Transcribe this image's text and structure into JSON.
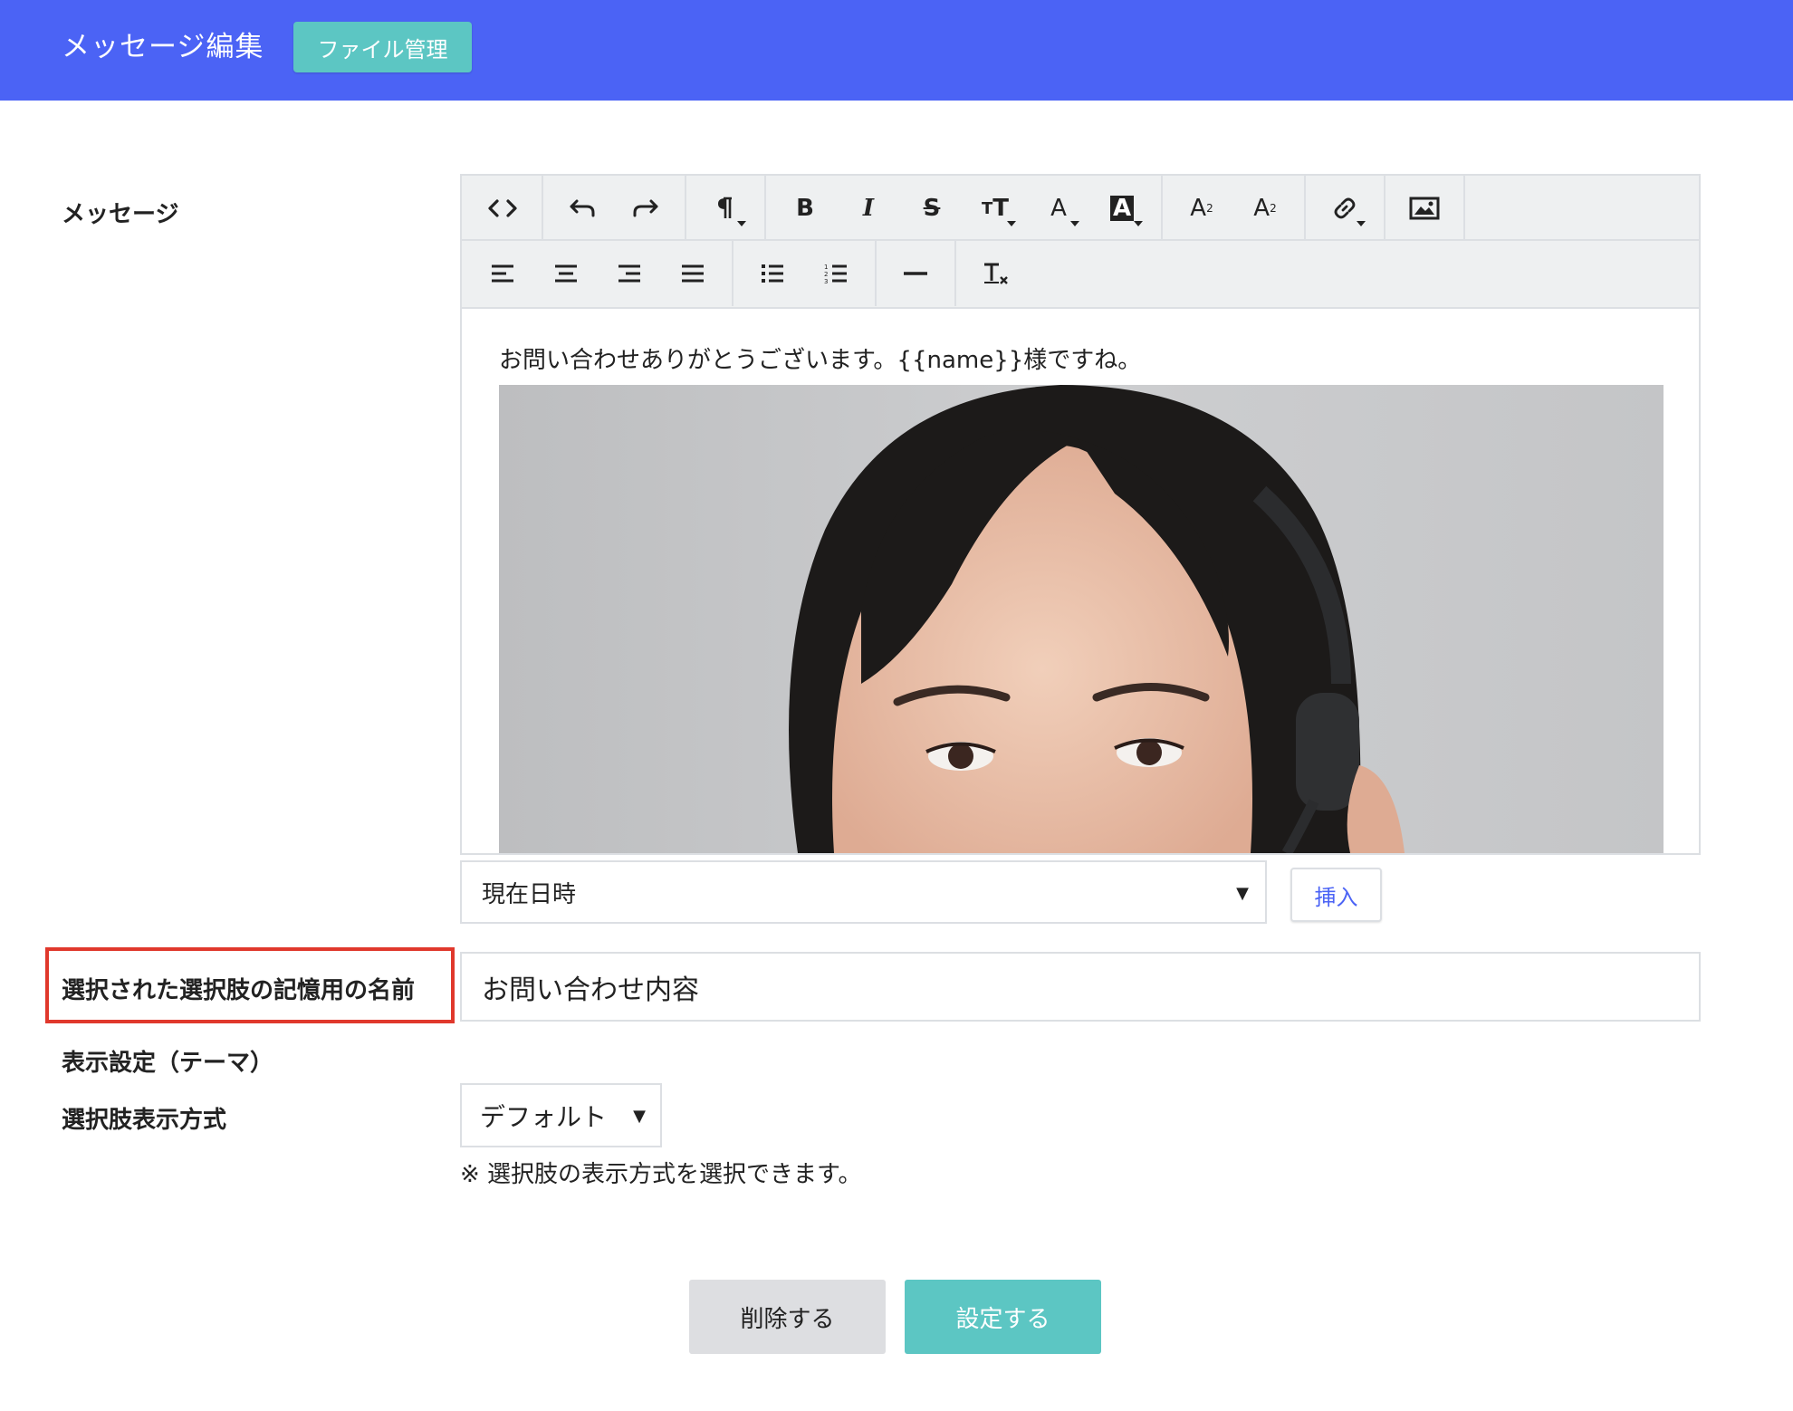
{
  "header": {
    "title": "メッセージ編集",
    "file_button": "ファイル管理"
  },
  "labels": {
    "message": "メッセージ",
    "memory_name": "選択された選択肢の記憶用の名前",
    "theme": "表示設定（テーマ）",
    "choice_display": "選択肢表示方式"
  },
  "editor": {
    "toolbar_row1": [
      "code-view-icon",
      "undo-icon",
      "redo-icon",
      "paragraph-icon",
      "bold-icon",
      "italic-icon",
      "strikethrough-icon",
      "font-size-icon",
      "font-color-icon",
      "highlight-color-icon",
      "superscript-icon",
      "subscript-icon",
      "link-icon",
      "image-icon"
    ],
    "toolbar_row2": [
      "align-left-icon",
      "align-center-icon",
      "align-right-icon",
      "align-justify-icon",
      "bullet-list-icon",
      "numbered-list-icon",
      "horizontal-rule-icon",
      "clear-format-icon"
    ],
    "body_text": "お問い合わせありがとうございます。{{name}}様ですね。"
  },
  "insert": {
    "selected": "現在日時",
    "button": "挿入"
  },
  "memory_name_value": "お問い合わせ内容",
  "choice_display": {
    "selected": "デフォルト",
    "note": "※ 選択肢の表示方式を選択できます。"
  },
  "buttons": {
    "delete": "削除する",
    "save": "設定する"
  },
  "colors": {
    "header": "#4b63f5",
    "accent_teal": "#5cc6c3",
    "highlight_border": "#e0382c"
  }
}
